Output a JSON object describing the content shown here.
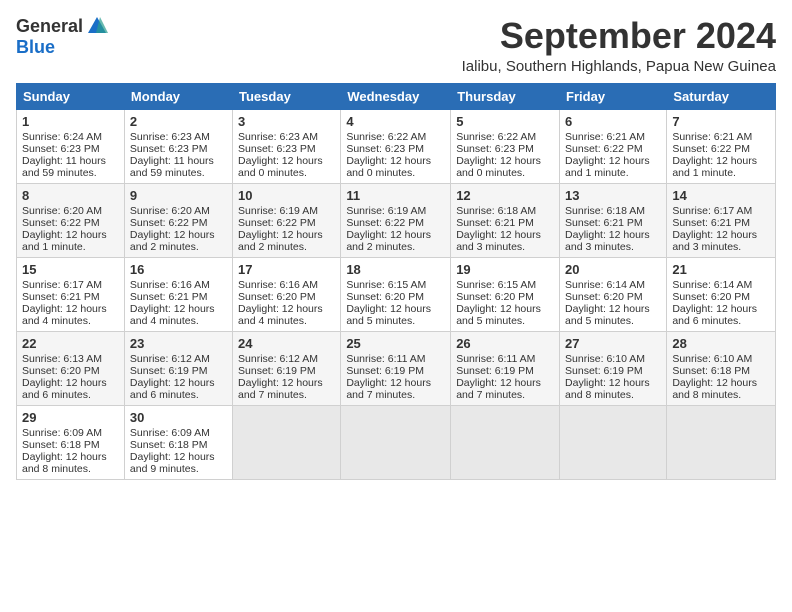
{
  "header": {
    "logo_general": "General",
    "logo_blue": "Blue",
    "month_title": "September 2024",
    "location": "Ialibu, Southern Highlands, Papua New Guinea"
  },
  "weekdays": [
    "Sunday",
    "Monday",
    "Tuesday",
    "Wednesday",
    "Thursday",
    "Friday",
    "Saturday"
  ],
  "weeks": [
    [
      {
        "day": "1",
        "sunrise": "Sunrise: 6:24 AM",
        "sunset": "Sunset: 6:23 PM",
        "daylight": "Daylight: 11 hours and 59 minutes."
      },
      {
        "day": "2",
        "sunrise": "Sunrise: 6:23 AM",
        "sunset": "Sunset: 6:23 PM",
        "daylight": "Daylight: 11 hours and 59 minutes."
      },
      {
        "day": "3",
        "sunrise": "Sunrise: 6:23 AM",
        "sunset": "Sunset: 6:23 PM",
        "daylight": "Daylight: 12 hours and 0 minutes."
      },
      {
        "day": "4",
        "sunrise": "Sunrise: 6:22 AM",
        "sunset": "Sunset: 6:23 PM",
        "daylight": "Daylight: 12 hours and 0 minutes."
      },
      {
        "day": "5",
        "sunrise": "Sunrise: 6:22 AM",
        "sunset": "Sunset: 6:23 PM",
        "daylight": "Daylight: 12 hours and 0 minutes."
      },
      {
        "day": "6",
        "sunrise": "Sunrise: 6:21 AM",
        "sunset": "Sunset: 6:22 PM",
        "daylight": "Daylight: 12 hours and 1 minute."
      },
      {
        "day": "7",
        "sunrise": "Sunrise: 6:21 AM",
        "sunset": "Sunset: 6:22 PM",
        "daylight": "Daylight: 12 hours and 1 minute."
      }
    ],
    [
      {
        "day": "8",
        "sunrise": "Sunrise: 6:20 AM",
        "sunset": "Sunset: 6:22 PM",
        "daylight": "Daylight: 12 hours and 1 minute."
      },
      {
        "day": "9",
        "sunrise": "Sunrise: 6:20 AM",
        "sunset": "Sunset: 6:22 PM",
        "daylight": "Daylight: 12 hours and 2 minutes."
      },
      {
        "day": "10",
        "sunrise": "Sunrise: 6:19 AM",
        "sunset": "Sunset: 6:22 PM",
        "daylight": "Daylight: 12 hours and 2 minutes."
      },
      {
        "day": "11",
        "sunrise": "Sunrise: 6:19 AM",
        "sunset": "Sunset: 6:22 PM",
        "daylight": "Daylight: 12 hours and 2 minutes."
      },
      {
        "day": "12",
        "sunrise": "Sunrise: 6:18 AM",
        "sunset": "Sunset: 6:21 PM",
        "daylight": "Daylight: 12 hours and 3 minutes."
      },
      {
        "day": "13",
        "sunrise": "Sunrise: 6:18 AM",
        "sunset": "Sunset: 6:21 PM",
        "daylight": "Daylight: 12 hours and 3 minutes."
      },
      {
        "day": "14",
        "sunrise": "Sunrise: 6:17 AM",
        "sunset": "Sunset: 6:21 PM",
        "daylight": "Daylight: 12 hours and 3 minutes."
      }
    ],
    [
      {
        "day": "15",
        "sunrise": "Sunrise: 6:17 AM",
        "sunset": "Sunset: 6:21 PM",
        "daylight": "Daylight: 12 hours and 4 minutes."
      },
      {
        "day": "16",
        "sunrise": "Sunrise: 6:16 AM",
        "sunset": "Sunset: 6:21 PM",
        "daylight": "Daylight: 12 hours and 4 minutes."
      },
      {
        "day": "17",
        "sunrise": "Sunrise: 6:16 AM",
        "sunset": "Sunset: 6:20 PM",
        "daylight": "Daylight: 12 hours and 4 minutes."
      },
      {
        "day": "18",
        "sunrise": "Sunrise: 6:15 AM",
        "sunset": "Sunset: 6:20 PM",
        "daylight": "Daylight: 12 hours and 5 minutes."
      },
      {
        "day": "19",
        "sunrise": "Sunrise: 6:15 AM",
        "sunset": "Sunset: 6:20 PM",
        "daylight": "Daylight: 12 hours and 5 minutes."
      },
      {
        "day": "20",
        "sunrise": "Sunrise: 6:14 AM",
        "sunset": "Sunset: 6:20 PM",
        "daylight": "Daylight: 12 hours and 5 minutes."
      },
      {
        "day": "21",
        "sunrise": "Sunrise: 6:14 AM",
        "sunset": "Sunset: 6:20 PM",
        "daylight": "Daylight: 12 hours and 6 minutes."
      }
    ],
    [
      {
        "day": "22",
        "sunrise": "Sunrise: 6:13 AM",
        "sunset": "Sunset: 6:20 PM",
        "daylight": "Daylight: 12 hours and 6 minutes."
      },
      {
        "day": "23",
        "sunrise": "Sunrise: 6:12 AM",
        "sunset": "Sunset: 6:19 PM",
        "daylight": "Daylight: 12 hours and 6 minutes."
      },
      {
        "day": "24",
        "sunrise": "Sunrise: 6:12 AM",
        "sunset": "Sunset: 6:19 PM",
        "daylight": "Daylight: 12 hours and 7 minutes."
      },
      {
        "day": "25",
        "sunrise": "Sunrise: 6:11 AM",
        "sunset": "Sunset: 6:19 PM",
        "daylight": "Daylight: 12 hours and 7 minutes."
      },
      {
        "day": "26",
        "sunrise": "Sunrise: 6:11 AM",
        "sunset": "Sunset: 6:19 PM",
        "daylight": "Daylight: 12 hours and 7 minutes."
      },
      {
        "day": "27",
        "sunrise": "Sunrise: 6:10 AM",
        "sunset": "Sunset: 6:19 PM",
        "daylight": "Daylight: 12 hours and 8 minutes."
      },
      {
        "day": "28",
        "sunrise": "Sunrise: 6:10 AM",
        "sunset": "Sunset: 6:18 PM",
        "daylight": "Daylight: 12 hours and 8 minutes."
      }
    ],
    [
      {
        "day": "29",
        "sunrise": "Sunrise: 6:09 AM",
        "sunset": "Sunset: 6:18 PM",
        "daylight": "Daylight: 12 hours and 8 minutes."
      },
      {
        "day": "30",
        "sunrise": "Sunrise: 6:09 AM",
        "sunset": "Sunset: 6:18 PM",
        "daylight": "Daylight: 12 hours and 9 minutes."
      },
      {
        "day": "",
        "sunrise": "",
        "sunset": "",
        "daylight": ""
      },
      {
        "day": "",
        "sunrise": "",
        "sunset": "",
        "daylight": ""
      },
      {
        "day": "",
        "sunrise": "",
        "sunset": "",
        "daylight": ""
      },
      {
        "day": "",
        "sunrise": "",
        "sunset": "",
        "daylight": ""
      },
      {
        "day": "",
        "sunrise": "",
        "sunset": "",
        "daylight": ""
      }
    ]
  ]
}
